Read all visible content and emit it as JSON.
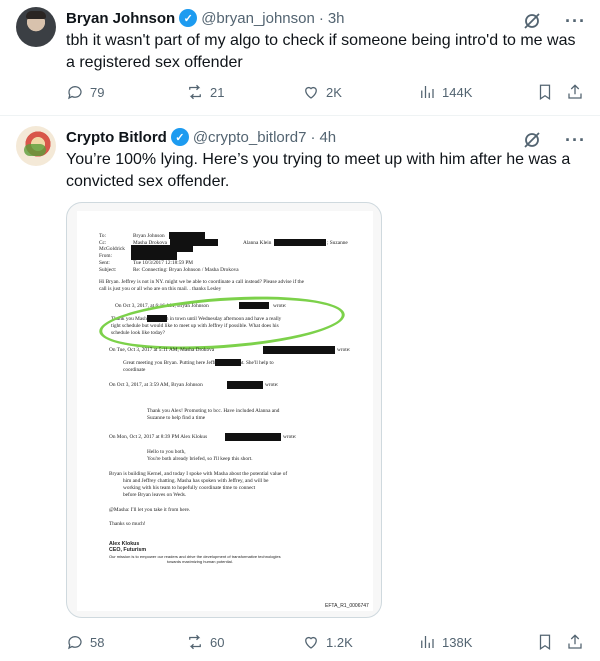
{
  "tweets": [
    {
      "name": "Bryan Johnson",
      "handle": "@bryan_johnson",
      "separator": "·",
      "time": "3h",
      "text": "tbh it wasn't part of my algo to check if someone being intro'd to me was a registered sex offender",
      "replies": "79",
      "reposts": "21",
      "likes": "2K",
      "views": "144K"
    },
    {
      "name": "Crypto Bitlord",
      "handle": "@crypto_bitlord7",
      "separator": "·",
      "time": "4h",
      "text": "You’re 100% lying. Here’s you trying to meet up with him after he was a convicted sex offender.",
      "replies": "58",
      "reposts": "60",
      "likes": "1.2K",
      "views": "138K"
    }
  ],
  "document": {
    "to": "To:",
    "to_val": "Bryan Johnson",
    "cc": "Cc:",
    "cc_val": "Masha Drokova",
    "cc_val2": "Alanna Klein",
    "cc_val3": "; Suzanne",
    "cc_val4": "McGoldrick",
    "from": "From:",
    "sent": "Sent:",
    "sent_val": "Tue 10/3/2017 12:18:59 PM",
    "subject": "Subject:",
    "subject_val": "Re: Connecting: Bryan Johnson / Masha Drokova",
    "p1": "Hi Bryan. Jeffrey is not in NY.   might we be able to coordinate a call instead?  Please advise if the",
    "p1b": "call is just you or all who are on  this mail. . thanks   Lesley",
    "on1": "On Oct 3, 2017, at 6:16 AM, Bryan Johnson",
    "wrote1": "wrote:",
    "q1": "Thank you Masha. Hi          - I'm in town until Wednesday afternoon and have a really",
    "q1b": "tight schedule but would like to meet up with Jeffrey if possible. What does his",
    "q1c": "schedule look like today?",
    "on2": "On Tue, Oct 3, 2017 at 5:11 AM, Masha Drokova",
    "wrote2": "wrote:",
    "q2": "Great meeting you Bryan. Putting here           Jeffrey's assistant. She'll help to",
    "q2b": "coordinate",
    "on3": "On Oct 3, 2017, at 3:59 AM, Bryan Johnson",
    "wrote3": "wrote:",
    "q3": "Thank you Alex! Promoting to bcc. Have included Alanna and",
    "q3b": "Suzanne to help find a time",
    "on4": "On Mon, Oct 2, 2017 at 8:39 PM Alex Klokus",
    "wrote4": "wrote:",
    "q4": "Hello to you both,",
    "q4b": "You're both already briefed, so I'll keep this short.",
    "q5": "Bryan is building Kernel, and today I spoke with Masha about the potential value of",
    "q5b": "him and Jeffrey chatting. Masha has spoken with Jeffrey, and will be",
    "q5c": "working with his team to hopefully coordinate time to connect",
    "q5d": "before Bryan leaves on Weds.",
    "q6": "@Masha: I'll let you take it from here.",
    "q7": "Thanks so much!",
    "sig1": "Alex Klokus",
    "sig2": "CEO, Futurism",
    "sig3": "Our mission is to empower our readers and drive the development of transformative technologies",
    "sig4": "towards maximizing human potential.",
    "footer": "EFTA_R1_0006747"
  },
  "icons": [
    "verified-badge-icon",
    "grok-icon",
    "more-icon",
    "reply-icon",
    "repost-icon",
    "like-icon",
    "views-icon",
    "bookmark-icon",
    "share-icon"
  ],
  "colors": {
    "accent": "#1d9bf0",
    "muted": "#536471",
    "highlight_oval": "#7cd14a"
  }
}
